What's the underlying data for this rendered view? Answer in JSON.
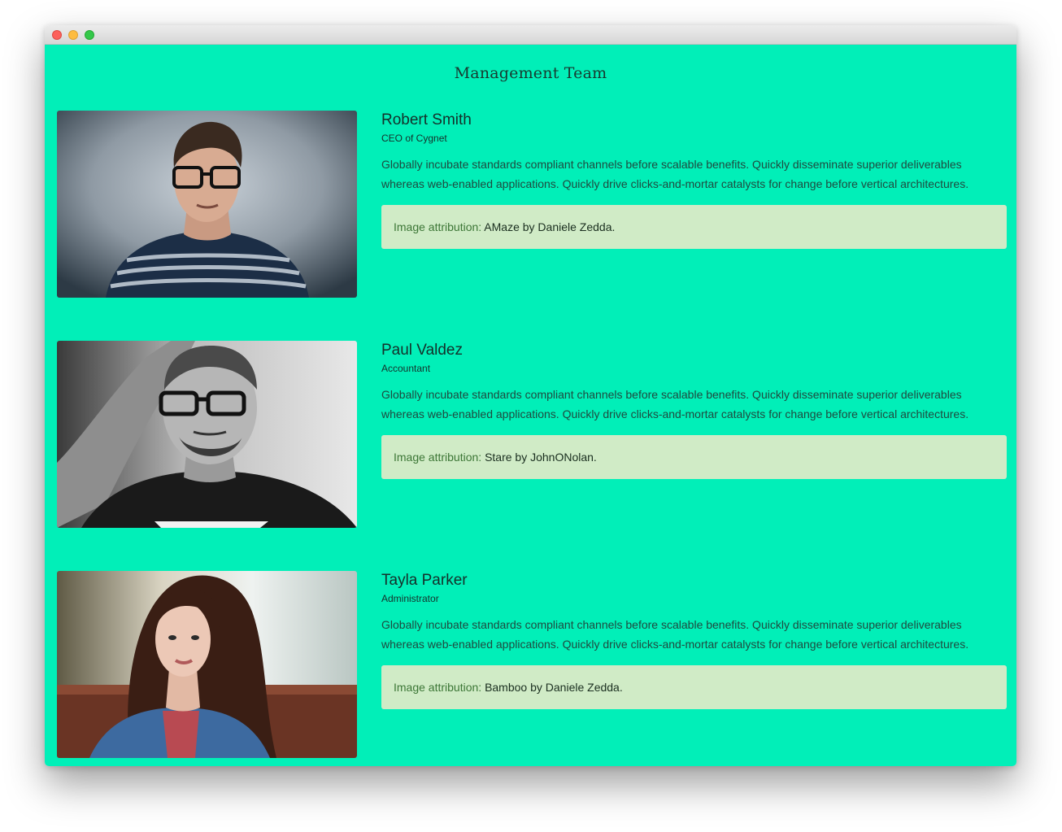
{
  "window": {
    "controls": [
      "close",
      "minimize",
      "zoom"
    ]
  },
  "page": {
    "title": "Management Team",
    "background_color": "#01efb8"
  },
  "members": [
    {
      "name": "Robert Smith",
      "role": "CEO of Cygnet",
      "bio": "Globally incubate standards compliant channels before scalable benefits. Quickly disseminate superior deliverables whereas web-enabled applications. Quickly drive clicks-and-mortar catalysts for change before vertical architectures.",
      "attribution_label": "Image attribution:",
      "attribution_text": "AMaze by Daniele Zedda."
    },
    {
      "name": "Paul Valdez",
      "role": "Accountant",
      "bio": "Globally incubate standards compliant channels before scalable benefits. Quickly disseminate superior deliverables whereas web-enabled applications. Quickly drive clicks-and-mortar catalysts for change before vertical architectures.",
      "attribution_label": "Image attribution:",
      "attribution_text": "Stare by JohnONolan."
    },
    {
      "name": "Tayla Parker",
      "role": "Administrator",
      "bio": "Globally incubate standards compliant channels before scalable benefits. Quickly disseminate superior deliverables whereas web-enabled applications. Quickly drive clicks-and-mortar catalysts for change before vertical architectures.",
      "attribution_label": "Image attribution:",
      "attribution_text": "Bamboo by Daniele Zedda."
    }
  ]
}
